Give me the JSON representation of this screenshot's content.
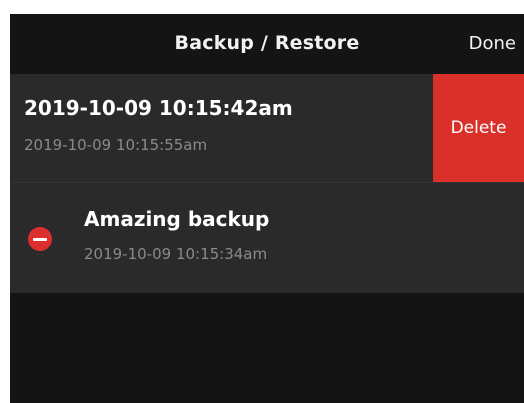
{
  "navbar": {
    "title": "Backup / Restore",
    "done_label": "Done"
  },
  "backups": [
    {
      "title": "2019-10-09 10:15:42am",
      "subtitle": "2019-10-09 10:15:55am",
      "swipe_action": "Delete"
    },
    {
      "title": "Amazing backup",
      "subtitle": "2019-10-09 10:15:34am",
      "edit_control": "minus-circle-icon"
    }
  ],
  "colors": {
    "background": "#141414",
    "row_background": "#2a2a2a",
    "delete_red": "#d9302a",
    "subtitle_gray": "#8a8a8a"
  }
}
